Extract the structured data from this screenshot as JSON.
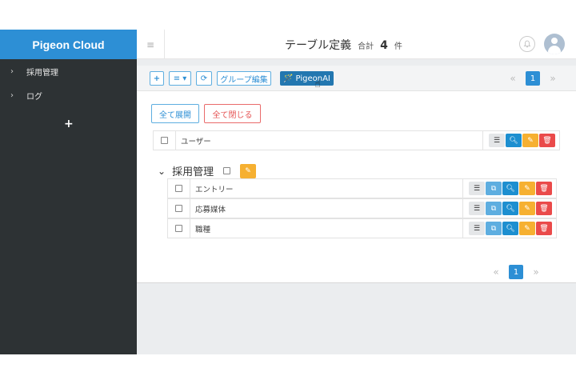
{
  "sidebar": {
    "brand": "Pigeon Cloud",
    "items": [
      {
        "label": "採用管理",
        "icon": "chevron-right-icon"
      },
      {
        "label": "ログ",
        "icon": "chevron-right-icon"
      }
    ],
    "add_icon": "plus-icon"
  },
  "header": {
    "menu_icon": "hamburger-icon",
    "title": "テーブル定義",
    "count_label": "合計",
    "count": "4",
    "count_unit": "件",
    "bell_icon": "bell-icon",
    "avatar_icon": "user-avatar-icon"
  },
  "toolbar": {
    "add_label": "+",
    "menu_label": "≡ ▾",
    "refresh_label": "⟳",
    "group_edit_label": "グループ編集",
    "pigeonai_label": "PigeonAI",
    "pager": {
      "prev": "«",
      "page": "1",
      "next": "»"
    }
  },
  "expand": {
    "expand_all": "全て展開",
    "collapse_all": "全て閉じる"
  },
  "top_rows": [
    {
      "name": "ユーザー"
    }
  ],
  "group": {
    "name": "採用管理",
    "rows": [
      {
        "name": "エントリー"
      },
      {
        "name": "応募媒体"
      },
      {
        "name": "職種"
      }
    ]
  },
  "bottom_pager": {
    "prev": "«",
    "page": "1",
    "next": "»"
  },
  "colors": {
    "brand": "#2d8fd5",
    "sidebar": "#2d3234",
    "pigeonai": "#2377b0",
    "edit": "#f6b031",
    "delete": "#ea4a4a"
  }
}
